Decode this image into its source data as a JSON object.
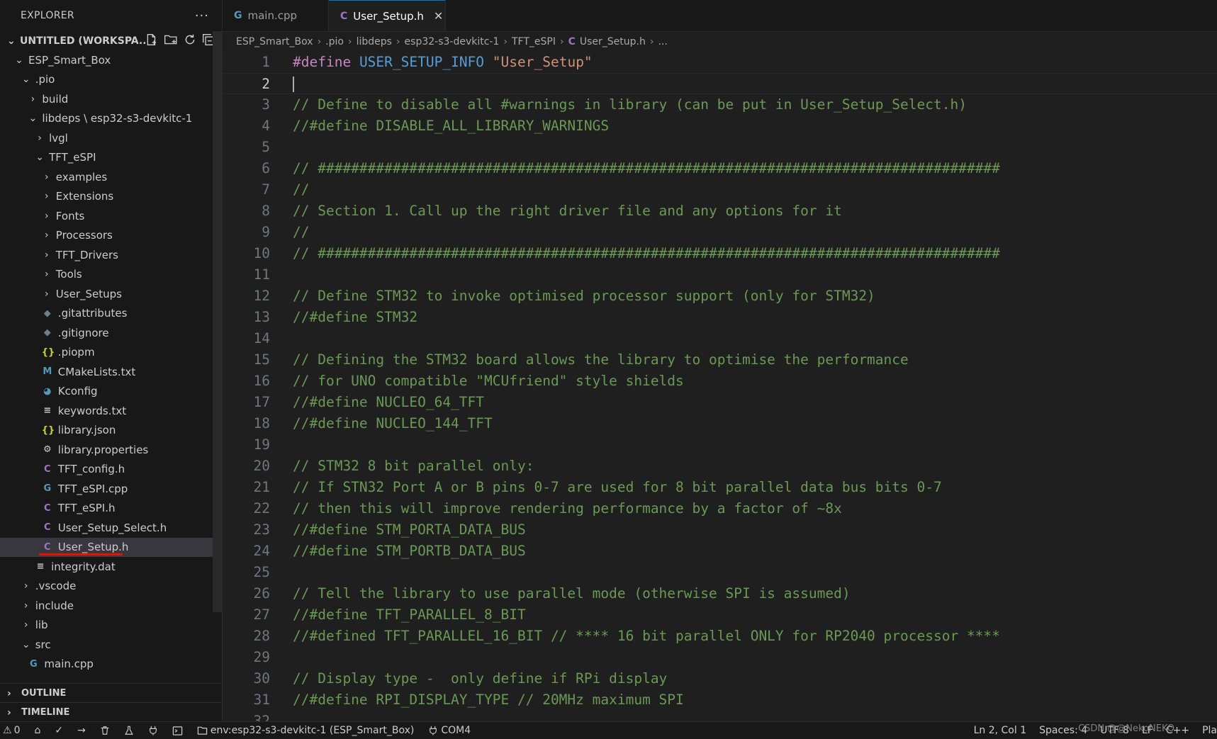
{
  "sidebar": {
    "title": "EXPLORER",
    "more_label": "···",
    "workspace_label": "UNTITLED (WORKSPA...",
    "tree": [
      {
        "label": "ESP_Smart_Box",
        "depth": 1,
        "type": "folder",
        "open": true
      },
      {
        "label": ".pio",
        "depth": 2,
        "type": "folder",
        "open": true
      },
      {
        "label": "build",
        "depth": 3,
        "type": "folder",
        "open": false
      },
      {
        "label": "libdeps \\ esp32-s3-devkitc-1",
        "depth": 3,
        "type": "folder",
        "open": true
      },
      {
        "label": "lvgl",
        "depth": 4,
        "type": "folder",
        "open": false
      },
      {
        "label": "TFT_eSPI",
        "depth": 4,
        "type": "folder",
        "open": true
      },
      {
        "label": "examples",
        "depth": 5,
        "type": "folder",
        "open": false
      },
      {
        "label": "Extensions",
        "depth": 5,
        "type": "folder",
        "open": false
      },
      {
        "label": "Fonts",
        "depth": 5,
        "type": "folder",
        "open": false
      },
      {
        "label": "Processors",
        "depth": 5,
        "type": "folder",
        "open": false
      },
      {
        "label": "TFT_Drivers",
        "depth": 5,
        "type": "folder",
        "open": false
      },
      {
        "label": "Tools",
        "depth": 5,
        "type": "folder",
        "open": false
      },
      {
        "label": "User_Setups",
        "depth": 5,
        "type": "folder",
        "open": false
      },
      {
        "label": ".gitattributes",
        "depth": 5,
        "type": "file",
        "icon": "git-icon"
      },
      {
        "label": ".gitignore",
        "depth": 5,
        "type": "file",
        "icon": "git-icon"
      },
      {
        "label": ".piopm",
        "depth": 5,
        "type": "file",
        "icon": "json-icon"
      },
      {
        "label": "CMakeLists.txt",
        "depth": 5,
        "type": "file",
        "icon": "cmake-icon"
      },
      {
        "label": "Kconfig",
        "depth": 5,
        "type": "file",
        "icon": "python-icon"
      },
      {
        "label": "keywords.txt",
        "depth": 5,
        "type": "file",
        "icon": "text-icon"
      },
      {
        "label": "library.json",
        "depth": 5,
        "type": "file",
        "icon": "json-icon"
      },
      {
        "label": "library.properties",
        "depth": 5,
        "type": "file",
        "icon": "gear-icon"
      },
      {
        "label": "TFT_config.h",
        "depth": 5,
        "type": "file",
        "icon": "c-header-icon"
      },
      {
        "label": "TFT_eSPI.cpp",
        "depth": 5,
        "type": "file",
        "icon": "cpp-icon"
      },
      {
        "label": "TFT_eSPI.h",
        "depth": 5,
        "type": "file",
        "icon": "c-header-icon"
      },
      {
        "label": "User_Setup_Select.h",
        "depth": 5,
        "type": "file",
        "icon": "c-header-icon"
      },
      {
        "label": "User_Setup.h",
        "depth": 5,
        "type": "file",
        "icon": "c-header-icon",
        "selected": true
      },
      {
        "label": "integrity.dat",
        "depth": 4,
        "type": "file",
        "icon": "text-icon"
      },
      {
        "label": ".vscode",
        "depth": 2,
        "type": "folder",
        "open": false
      },
      {
        "label": "include",
        "depth": 2,
        "type": "folder",
        "open": false
      },
      {
        "label": "lib",
        "depth": 2,
        "type": "folder",
        "open": false
      },
      {
        "label": "src",
        "depth": 2,
        "type": "folder",
        "open": true
      },
      {
        "label": "main.cpp",
        "depth": 3,
        "type": "file",
        "icon": "cpp-icon"
      }
    ],
    "outline_label": "OUTLINE",
    "timeline_label": "TIMELINE"
  },
  "tabs": [
    {
      "label": "main.cpp",
      "icon": "cpp-icon",
      "active": false
    },
    {
      "label": "User_Setup.h",
      "icon": "c-header-icon",
      "active": true
    }
  ],
  "breadcrumb": [
    "ESP_Smart_Box",
    ".pio",
    "libdeps",
    "esp32-s3-devkitc-1",
    "TFT_eSPI",
    "User_Setup.h",
    "..."
  ],
  "editor": {
    "current_line": 2,
    "lines": [
      {
        "n": "1",
        "kw": "#define",
        "macro": "USER_SETUP_INFO",
        "str": "\"User_Setup\""
      },
      {
        "n": "2",
        "text": ""
      },
      {
        "n": "3",
        "cmt": "// Define to disable all #warnings in library (can be put in User_Setup_Select.h)"
      },
      {
        "n": "4",
        "cmt": "//#define DISABLE_ALL_LIBRARY_WARNINGS"
      },
      {
        "n": "5",
        "text": ""
      },
      {
        "n": "6",
        "cmt": "// ##################################################################################"
      },
      {
        "n": "7",
        "cmt": "//"
      },
      {
        "n": "8",
        "cmt": "// Section 1. Call up the right driver file and any options for it"
      },
      {
        "n": "9",
        "cmt": "//"
      },
      {
        "n": "10",
        "cmt": "// ##################################################################################"
      },
      {
        "n": "11",
        "text": ""
      },
      {
        "n": "12",
        "cmt": "// Define STM32 to invoke optimised processor support (only for STM32)"
      },
      {
        "n": "13",
        "cmt": "//#define STM32"
      },
      {
        "n": "14",
        "text": ""
      },
      {
        "n": "15",
        "cmt": "// Defining the STM32 board allows the library to optimise the performance"
      },
      {
        "n": "16",
        "cmt": "// for UNO compatible \"MCUfriend\" style shields"
      },
      {
        "n": "17",
        "cmt": "//#define NUCLEO_64_TFT"
      },
      {
        "n": "18",
        "cmt": "//#define NUCLEO_144_TFT"
      },
      {
        "n": "19",
        "text": ""
      },
      {
        "n": "20",
        "cmt": "// STM32 8 bit parallel only:"
      },
      {
        "n": "21",
        "cmt": "// If STN32 Port A or B pins 0-7 are used for 8 bit parallel data bus bits 0-7"
      },
      {
        "n": "22",
        "cmt": "// then this will improve rendering performance by a factor of ~8x"
      },
      {
        "n": "23",
        "cmt": "//#define STM_PORTA_DATA_BUS"
      },
      {
        "n": "24",
        "cmt": "//#define STM_PORTB_DATA_BUS"
      },
      {
        "n": "25",
        "text": ""
      },
      {
        "n": "26",
        "cmt": "// Tell the library to use parallel mode (otherwise SPI is assumed)"
      },
      {
        "n": "27",
        "cmt": "//#define TFT_PARALLEL_8_BIT"
      },
      {
        "n": "28",
        "cmt": "//#defined TFT_PARALLEL_16_BIT // **** 16 bit parallel ONLY for RP2040 processor ****"
      },
      {
        "n": "29",
        "text": ""
      },
      {
        "n": "30",
        "cmt": "// Display type -  only define if RPi display"
      },
      {
        "n": "31",
        "cmt": "//#define RPI_DISPLAY_TYPE // 20MHz maximum SPI"
      },
      {
        "n": "32",
        "text": ""
      }
    ]
  },
  "statusbar": {
    "problems": "0",
    "env_label": "env:esp32-s3-devkitc-1 (ESP_Smart_Box)",
    "port_label": "COM4",
    "position": "Ln 2, Col 1",
    "spaces": "Spaces: 4",
    "encoding": "UTF-8",
    "eol": "LF",
    "language": "C++",
    "platform": "Pla",
    "watermark": "CSDN @@NekoNEKO"
  },
  "colors": {
    "accent": "#0078d4",
    "keyword": "#c586c0",
    "macro": "#569cd6",
    "string": "#ce9178",
    "comment": "#6a9955",
    "highlight_underline": "#e51400"
  }
}
